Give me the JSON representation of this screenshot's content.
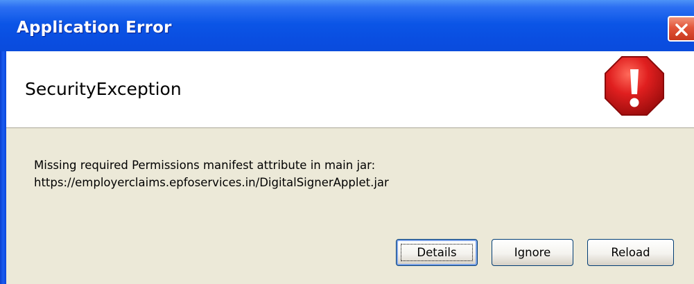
{
  "window": {
    "title": "Application Error"
  },
  "header": {
    "title": "SecurityException",
    "icon": "error-stop-icon"
  },
  "message": {
    "line1": "Missing required Permissions manifest attribute in main jar:",
    "line2": "https://employerclaims.epfoservices.in/DigitalSignerApplet.jar"
  },
  "buttons": {
    "details": "Details",
    "ignore": "Ignore",
    "reload": "Reload"
  },
  "colors": {
    "titlebar": "#0b55e6",
    "client": "#ece9d8",
    "error_red": "#d62020"
  }
}
